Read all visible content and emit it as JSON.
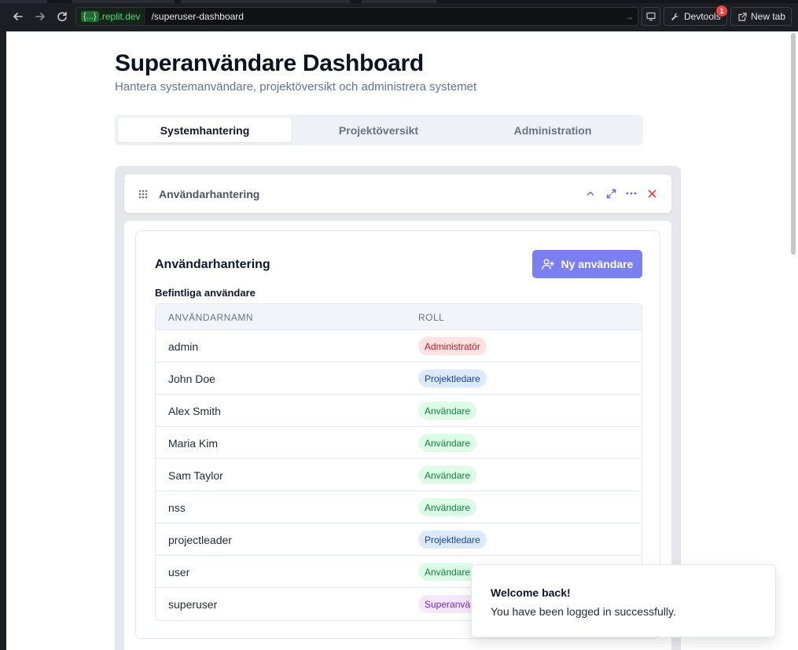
{
  "browser": {
    "url_domain_prefix": "{...}",
    "url_domain": ".replit.dev",
    "url_path": "/superuser-dashboard",
    "devtools_label": "Devtools",
    "devtools_badge": "1",
    "new_tab_label": "New tab"
  },
  "page": {
    "title": "Superanvändare Dashboard",
    "subtitle": "Hantera systemanvändare, projektöversikt och administrera systemet"
  },
  "tabs": [
    {
      "label": "Systemhantering",
      "active": true
    },
    {
      "label": "Projektöversikt",
      "active": false
    },
    {
      "label": "Administration",
      "active": false
    }
  ],
  "widget": {
    "title": "Användarhantering",
    "controls": [
      "chevron-up-icon",
      "expand-icon",
      "more-icon",
      "close-icon"
    ]
  },
  "card": {
    "title": "Användarhantering",
    "new_user_button": "Ny användare",
    "section_label": "Befintliga användare",
    "columns": [
      "ANVÄNDARNAMN",
      "ROLL"
    ],
    "users": [
      {
        "name": "admin",
        "role": "Administratör",
        "role_type": "admin"
      },
      {
        "name": "John Doe",
        "role": "Projektledare",
        "role_type": "pm"
      },
      {
        "name": "Alex Smith",
        "role": "Användare",
        "role_type": "user"
      },
      {
        "name": "Maria Kim",
        "role": "Användare",
        "role_type": "user"
      },
      {
        "name": "Sam Taylor",
        "role": "Användare",
        "role_type": "user"
      },
      {
        "name": "nss",
        "role": "Användare",
        "role_type": "user"
      },
      {
        "name": "projectleader",
        "role": "Projektledare",
        "role_type": "pm"
      },
      {
        "name": "user",
        "role": "Användare",
        "role_type": "user"
      },
      {
        "name": "superuser",
        "role": "Superanvändare",
        "role_type": "super"
      }
    ]
  },
  "role_colors": {
    "admin": {
      "bg": "#fee2e2",
      "fg": "#b91c1c"
    },
    "pm": {
      "bg": "#dbeafe",
      "fg": "#1e40af"
    },
    "user": {
      "bg": "#dcfce7",
      "fg": "#15803d"
    },
    "super": {
      "bg": "#f3e8ff",
      "fg": "#7e22ce"
    }
  },
  "toast": {
    "title": "Welcome back!",
    "message": "You have been logged in successfully."
  },
  "colors": {
    "accent": "#7c7ff2",
    "danger": "#ef4444"
  }
}
